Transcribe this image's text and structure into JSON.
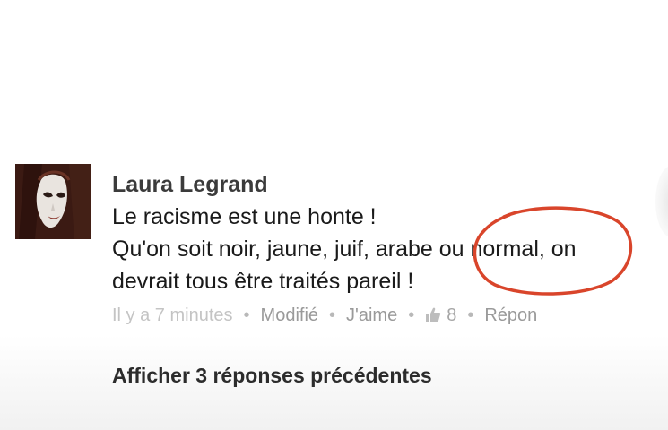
{
  "comment": {
    "author": "Laura Legrand",
    "lines": [
      "Le racisme est une honte !",
      "Qu'on soit noir, jaune, juif, arabe ou normal, on",
      "devrait tous être traités pareil !"
    ],
    "meta": {
      "timestamp": "Il y a 7 minutes",
      "edited": "Modifié",
      "like": "J'aime",
      "like_count": "8",
      "reply": "Répon"
    }
  },
  "show_previous_replies": "Afficher 3 réponses précédentes",
  "colors": {
    "annotation_circle": "#d9452b",
    "author": "#3b3b3b",
    "meta": "#a6a6a6"
  }
}
